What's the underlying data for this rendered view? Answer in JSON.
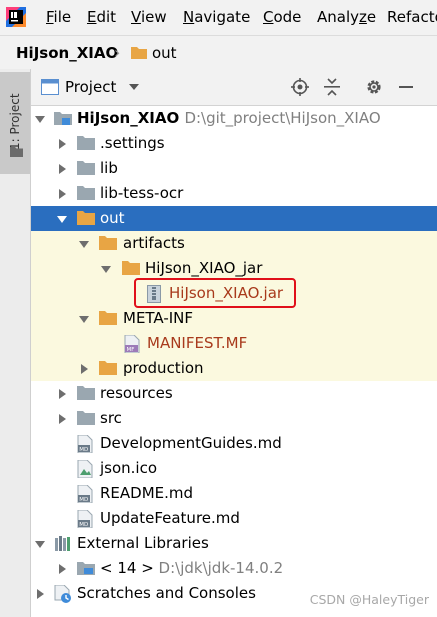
{
  "menu": {
    "file": {
      "u": "F",
      "rest": "ile"
    },
    "edit": {
      "u": "E",
      "rest": "dit"
    },
    "view": {
      "u": "V",
      "rest": "iew"
    },
    "navigate": {
      "u": "N",
      "rest": "avigate"
    },
    "code": {
      "u": "C",
      "rest": "ode"
    },
    "analyze": {
      "pre": "Analy",
      "u": "z",
      "rest": "e"
    },
    "refactor": {
      "pre": "Refacto",
      "u": "",
      "rest": ""
    }
  },
  "breadcrumb": {
    "project": "HiJson_XIAO",
    "folder": "out"
  },
  "side_tab": {
    "label": "1: Project"
  },
  "panel": {
    "title": "Project"
  },
  "tree": {
    "root": {
      "name": "HiJson_XIAO",
      "path": "D:\\git_project\\HiJson_XIAO"
    },
    "settings": ".settings",
    "lib": "lib",
    "lib_tess_ocr": "lib-tess-ocr",
    "out": "out",
    "artifacts": "artifacts",
    "hijson_jar_dir": "HiJson_XIAO_jar",
    "hijson_jar": "HiJson_XIAO.jar",
    "meta_inf": "META-INF",
    "manifest": "MANIFEST.MF",
    "production": "production",
    "resources": "resources",
    "src": "src",
    "dev_guides": "DevelopmentGuides.md",
    "json_ico": "json.ico",
    "readme": "README.md",
    "update_feature": "UpdateFeature.md",
    "external_libraries": "External Libraries",
    "jdk": {
      "name": "< 14 >",
      "path": "D:\\jdk\\jdk-14.0.2"
    },
    "scratches": "Scratches and Consoles"
  },
  "watermark": "CSDN @HaleyTiger",
  "colors": {
    "selection": "#2a6ebf",
    "highlight_row": "#fbf9df",
    "folder": "#e8a544",
    "annotation_box": "#e0101a",
    "file_red": "#a83a1c"
  }
}
